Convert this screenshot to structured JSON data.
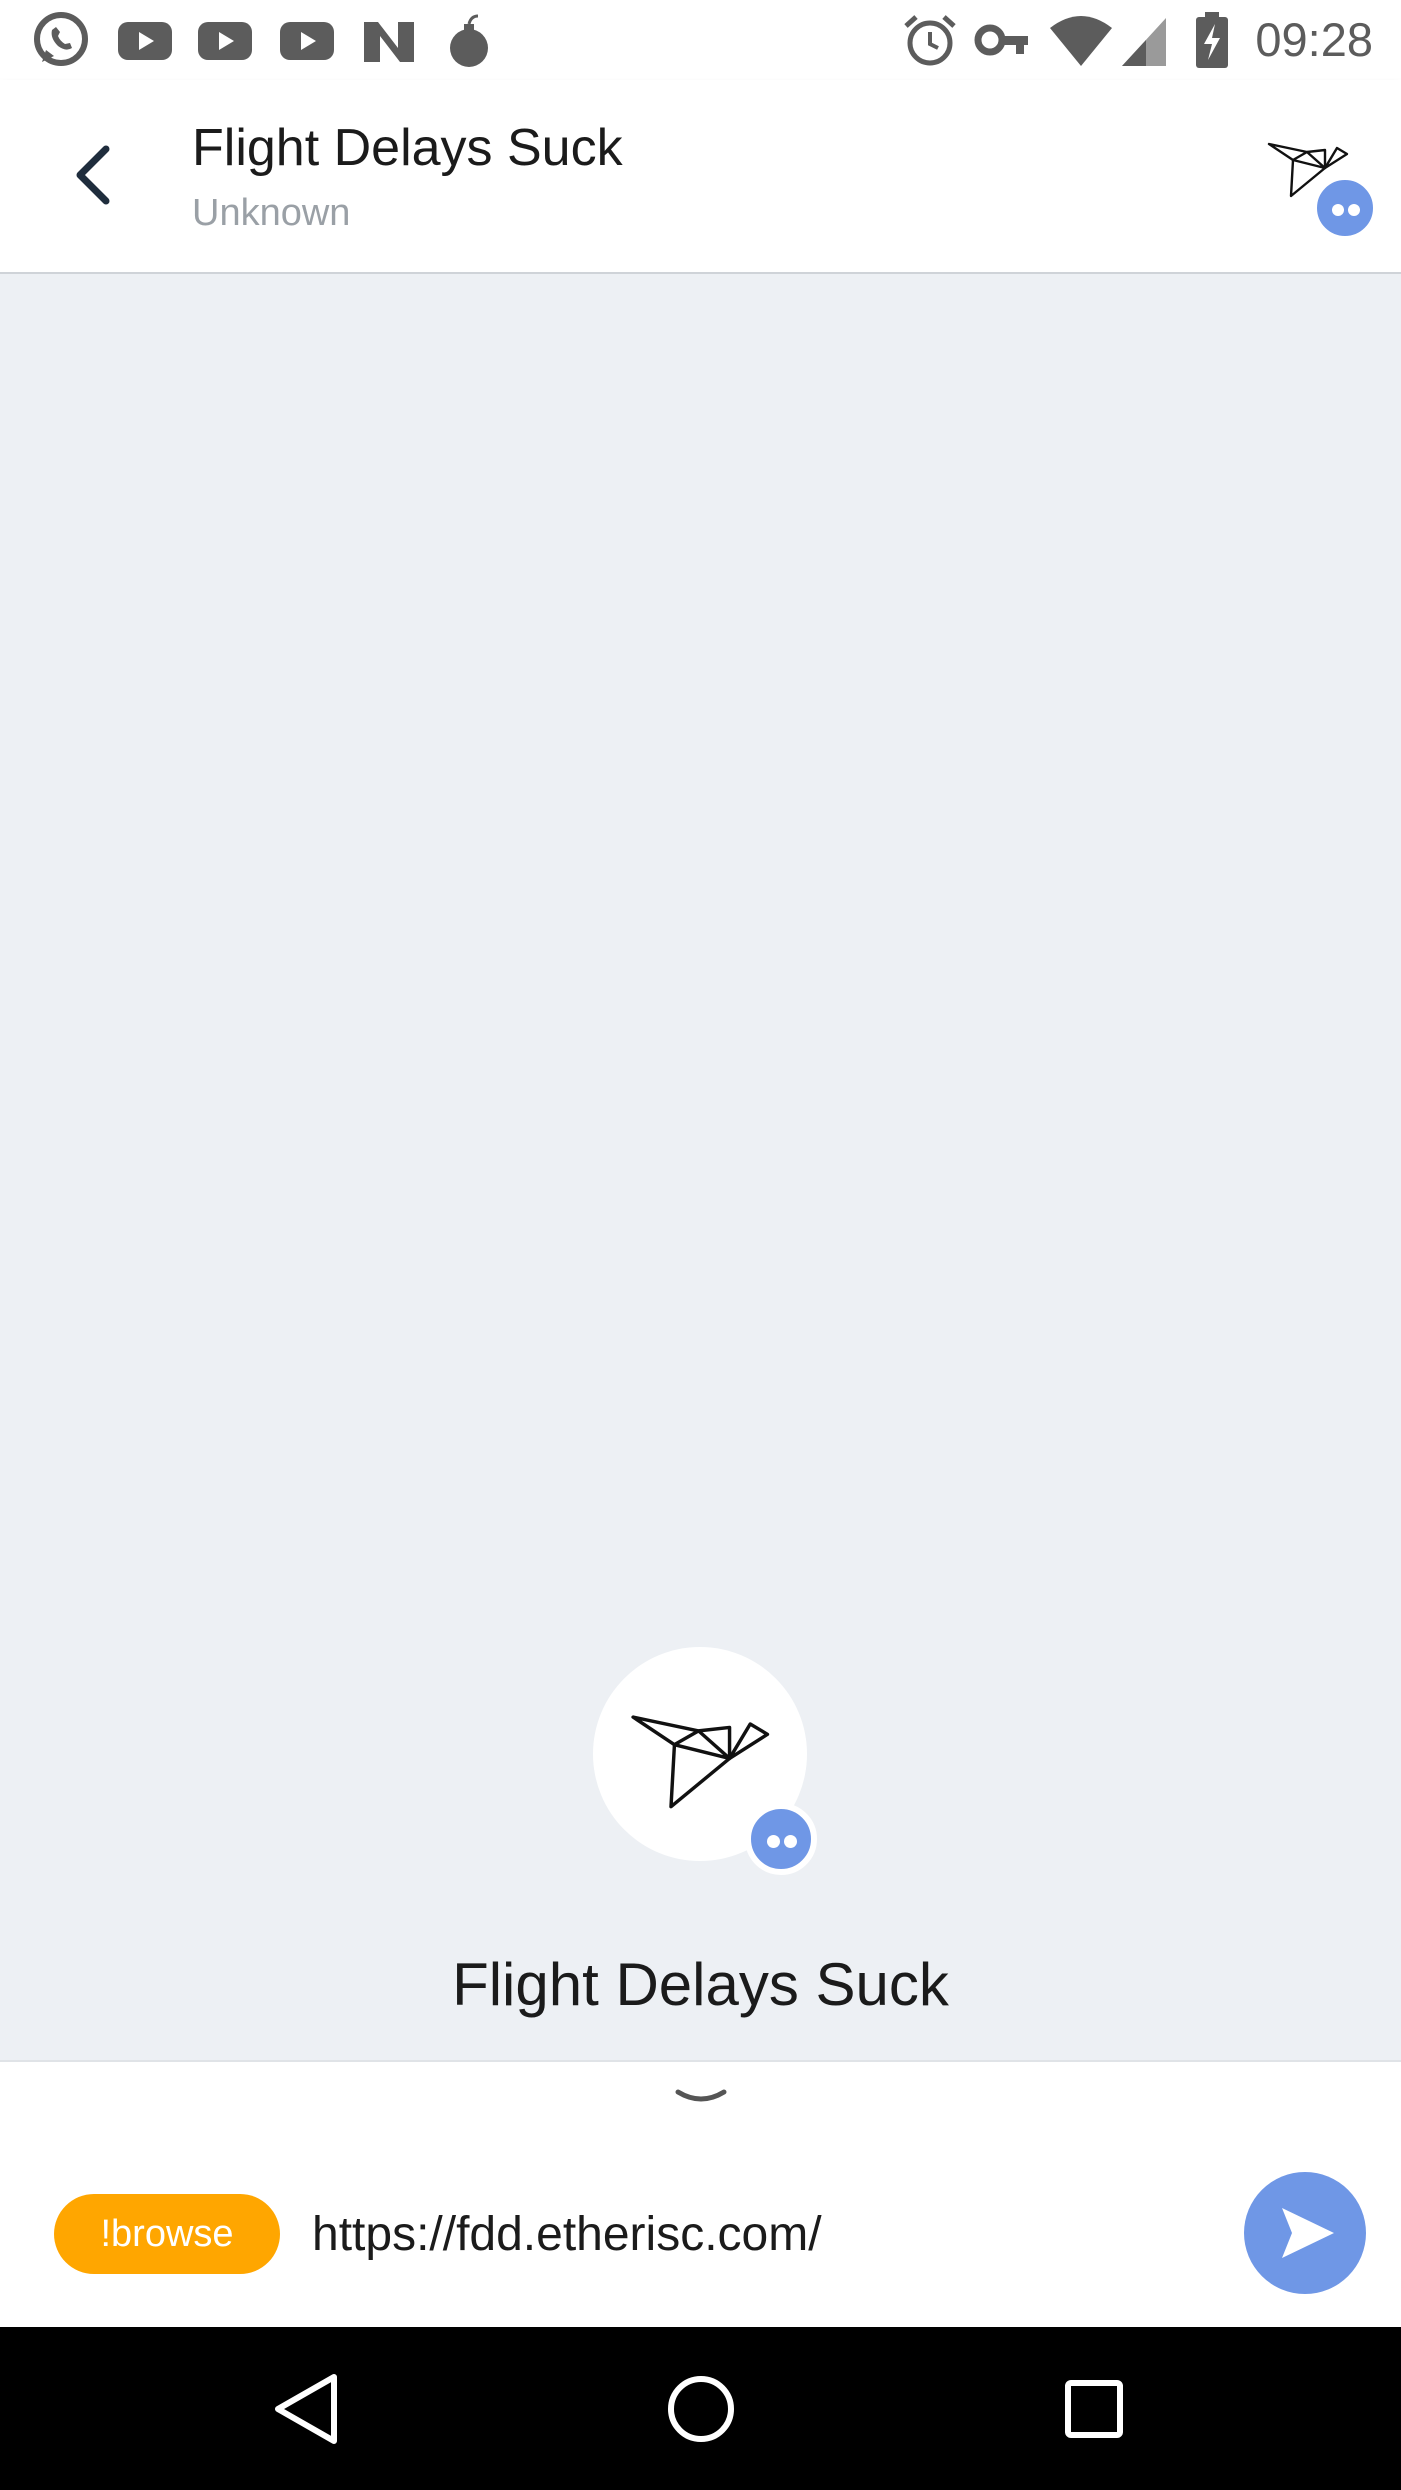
{
  "status_bar": {
    "time": "09:28",
    "notification_icons": [
      "whatsapp-icon",
      "youtube-icon",
      "youtube-icon",
      "youtube-icon",
      "n-app-icon",
      "bomb-icon"
    ],
    "system_icons": [
      "alarm-icon",
      "vpn-key-icon",
      "wifi-icon",
      "signal-icon",
      "battery-charging-icon"
    ]
  },
  "header": {
    "title": "Flight Delays Suck",
    "subtitle": "Unknown",
    "back_icon": "chevron-left-icon",
    "avatar_icon": "origami-bird-icon"
  },
  "profile": {
    "name": "Flight Delays Suck",
    "avatar_icon": "origami-bird-icon",
    "badge_icon": "dapp-dots-icon"
  },
  "composer": {
    "command": "!browse",
    "input_value": "https://fdd.etherisc.com/",
    "send_icon": "send-arrow-icon",
    "collapse_icon": "chevron-down-icon"
  },
  "colors": {
    "accent_blue": "#6f97e6",
    "command_orange": "#ffa600",
    "background": "#edf0f4"
  },
  "nav_bar": {
    "buttons": [
      "back-triangle-icon",
      "home-circle-icon",
      "recents-square-icon"
    ]
  }
}
